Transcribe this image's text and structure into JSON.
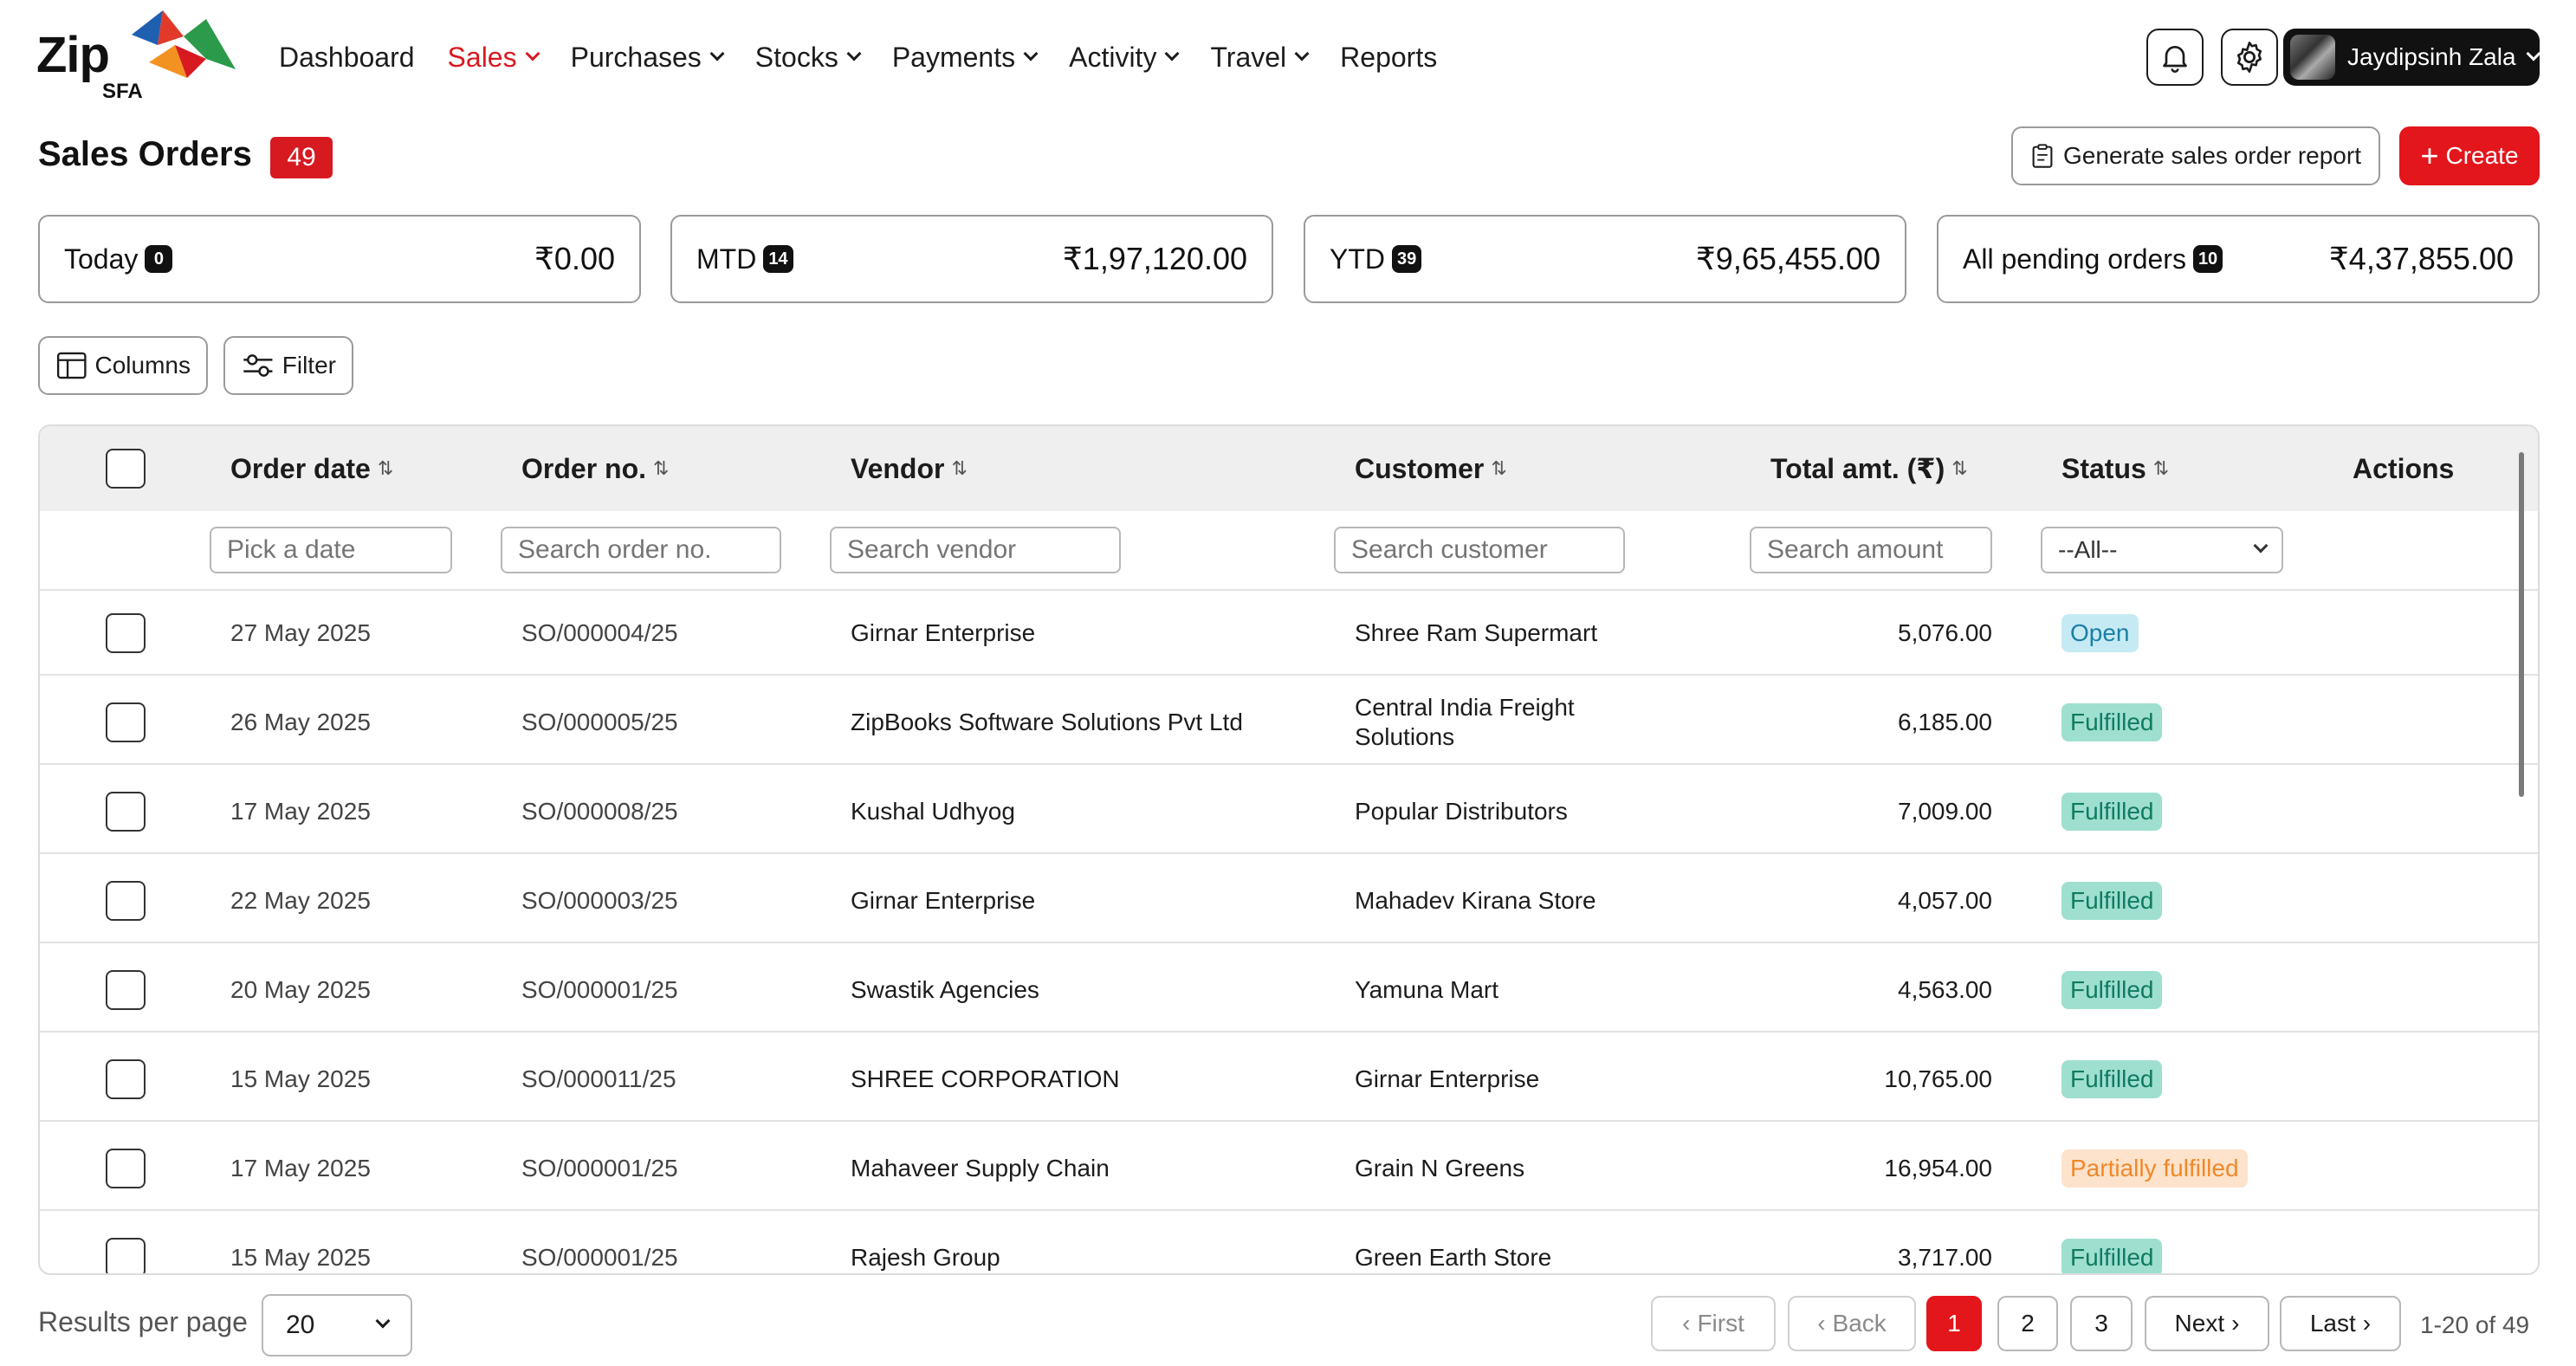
{
  "brand": {
    "name": "Zip",
    "sub": "SFA"
  },
  "nav": [
    {
      "label": "Dashboard",
      "dropdown": false,
      "active": false
    },
    {
      "label": "Sales",
      "dropdown": true,
      "active": true
    },
    {
      "label": "Purchases",
      "dropdown": true,
      "active": false
    },
    {
      "label": "Stocks",
      "dropdown": true,
      "active": false
    },
    {
      "label": "Payments",
      "dropdown": true,
      "active": false
    },
    {
      "label": "Activity",
      "dropdown": true,
      "active": false
    },
    {
      "label": "Travel",
      "dropdown": true,
      "active": false
    },
    {
      "label": "Reports",
      "dropdown": false,
      "active": false
    }
  ],
  "user": {
    "name": "Jaydipsinh Zala"
  },
  "page": {
    "title": "Sales Orders",
    "count": "49",
    "report_button": "Generate sales order report",
    "create_button": "Create"
  },
  "summary": [
    {
      "label": "Today",
      "badge": "0",
      "value": "₹0.00"
    },
    {
      "label": "MTD",
      "badge": "14",
      "value": "₹1,97,120.00"
    },
    {
      "label": "YTD",
      "badge": "39",
      "value": "₹9,65,455.00"
    },
    {
      "label": "All pending orders",
      "badge": "10",
      "value": "₹4,37,855.00"
    }
  ],
  "tools": {
    "columns": "Columns",
    "filter": "Filter"
  },
  "table": {
    "headers": {
      "order_date": "Order date",
      "order_no": "Order no.",
      "vendor": "Vendor",
      "customer": "Customer",
      "total": "Total amt. (₹)",
      "status": "Status",
      "actions": "Actions"
    },
    "filters": {
      "date": "Pick a date",
      "order_no": "Search order no.",
      "vendor": "Search vendor",
      "customer": "Search customer",
      "amount": "Search amount",
      "status": "--All--"
    },
    "rows": [
      {
        "date": "27 May 2025",
        "order_no": "SO/000004/25",
        "vendor": "Girnar Enterprise",
        "customer": [
          "Shree Ram Supermart"
        ],
        "total": "5,076.00",
        "status": "Open",
        "status_kind": "open"
      },
      {
        "date": "26 May 2025",
        "order_no": "SO/000005/25",
        "vendor": "ZipBooks Software Solutions Pvt Ltd",
        "customer": [
          "Central India Freight",
          "Solutions"
        ],
        "total": "6,185.00",
        "status": "Fulfilled",
        "status_kind": "fulfilled"
      },
      {
        "date": "17 May 2025",
        "order_no": "SO/000008/25",
        "vendor": "Kushal Udhyog",
        "customer": [
          "Popular Distributors"
        ],
        "total": "7,009.00",
        "status": "Fulfilled",
        "status_kind": "fulfilled"
      },
      {
        "date": "22 May 2025",
        "order_no": "SO/000003/25",
        "vendor": "Girnar Enterprise",
        "customer": [
          "Mahadev Kirana Store"
        ],
        "total": "4,057.00",
        "status": "Fulfilled",
        "status_kind": "fulfilled"
      },
      {
        "date": "20 May 2025",
        "order_no": "SO/000001/25",
        "vendor": "Swastik Agencies",
        "customer": [
          "Yamuna Mart"
        ],
        "total": "4,563.00",
        "status": "Fulfilled",
        "status_kind": "fulfilled"
      },
      {
        "date": "15 May 2025",
        "order_no": "SO/000011/25",
        "vendor": "SHREE CORPORATION",
        "customer": [
          "Girnar Enterprise"
        ],
        "total": "10,765.00",
        "status": "Fulfilled",
        "status_kind": "fulfilled"
      },
      {
        "date": "17 May 2025",
        "order_no": "SO/000001/25",
        "vendor": "Mahaveer Supply Chain",
        "customer": [
          "Grain N Greens"
        ],
        "total": "16,954.00",
        "status": "Partially fulfilled",
        "status_kind": "partial"
      },
      {
        "date": "15 May 2025",
        "order_no": "SO/000001/25",
        "vendor": "Rajesh Group",
        "customer": [
          "Green Earth Store"
        ],
        "total": "3,717.00",
        "status": "Fulfilled",
        "status_kind": "fulfilled"
      }
    ]
  },
  "pagination": {
    "results_label": "Results per page",
    "per_page": "20",
    "first": "First",
    "back": "Back",
    "pages": [
      "1",
      "2",
      "3"
    ],
    "current_page": "1",
    "next": "Next",
    "last": "Last",
    "range": "1-20 of 49"
  },
  "colors": {
    "accent": "#e3161c",
    "open": "#c6eaf4",
    "fulfilled": "#9fdfd0",
    "partial": "#fde3cc"
  }
}
